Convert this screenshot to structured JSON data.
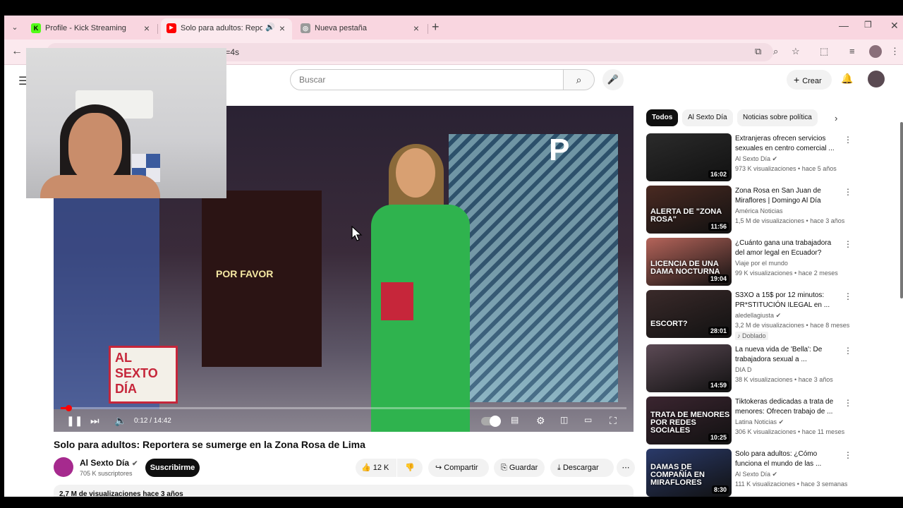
{
  "browser": {
    "tabs": [
      {
        "title": "Profile - Kick Streaming",
        "favicon": "K",
        "favicon_color": "#53fc18"
      },
      {
        "title": "Solo para adultos: Reporter",
        "favicon": "▶",
        "favicon_color": "#ff0000"
      },
      {
        "title": "Nueva pestaña",
        "favicon": "◎",
        "favicon_color": "#666666"
      }
    ],
    "url_visible": "t=4s"
  },
  "youtube": {
    "search_placeholder": "Buscar",
    "create_label": "Crear"
  },
  "player": {
    "overlay_text": "POR FAVOR",
    "show_logo_lines": [
      "AL",
      "SEXTO",
      "DÍA"
    ],
    "timecode": "0:12 / 14:42",
    "progress_fraction": 0.0136
  },
  "video": {
    "title": "Solo para adultos: Reportera se sumerge en la Zona Rosa de Lima",
    "channel": "Al Sexto Día",
    "subscribers": "705 K suscriptores",
    "subscribe_label": "Suscribirme",
    "likes": "12 K",
    "share_label": "Compartir",
    "save_label": "Guardar",
    "download_label": "Descargar",
    "views_line": "2,7 M de visualizaciones  hace 3 años"
  },
  "sidebar": {
    "chips": [
      "Todos",
      "Al Sexto Día",
      "Noticias sobre política"
    ],
    "recommendations": [
      {
        "title": "Extranjeras ofrecen servicios sexuales en centro comercial ...",
        "channel": "Al Sexto Día",
        "verified": true,
        "meta": "973 K visualizaciones • hace 5 años",
        "duration": "16:02",
        "thumb_color": "#2b2b2b",
        "thumb_text": ""
      },
      {
        "title": "Zona Rosa en San Juan de Miraflores | Domingo Al Día",
        "channel": "América Noticias",
        "verified": false,
        "meta": "1,5 M de visualizaciones • hace 3 años",
        "duration": "11:56",
        "thumb_color": "#4a2a22",
        "thumb_text": "ALERTA DE \"ZONA ROSA\""
      },
      {
        "title": "¿Cuánto gana una trabajadora del amor legal en Ecuador?",
        "channel": "Viaje por el mundo",
        "verified": false,
        "meta": "99 K visualizaciones • hace 2 meses",
        "duration": "19:04",
        "thumb_color": "#b5645a",
        "thumb_text": "LICENCIA DE UNA DAMA NOCTURNA"
      },
      {
        "title": "S3XO a 15$ por 12 minutos: PR*STITUCIÓN ILEGAL en ...",
        "channel": "aledellagiusta",
        "verified": true,
        "meta": "3,2 M de visualizaciones • hace 8 meses",
        "duration": "28:01",
        "thumb_color": "#3a2a2a",
        "thumb_text": "ESCORT?",
        "badge": "Doblado"
      },
      {
        "title": "La nueva vida de 'Bella': De trabajadora sexual a ...",
        "channel": "DIA D",
        "verified": false,
        "meta": "38 K visualizaciones • hace 3 años",
        "duration": "14:59",
        "thumb_color": "#5c4a55",
        "thumb_text": ""
      },
      {
        "title": "Tiktokeras dedicadas a trata de menores: Ofrecen trabajo de ...",
        "channel": "Latina Noticias",
        "verified": true,
        "meta": "306 K visualizaciones • hace 11 meses",
        "duration": "10:25",
        "thumb_color": "#3b2530",
        "thumb_text": "TRATA DE MENORES POR REDES SOCIALES"
      },
      {
        "title": "Solo para adultos: ¿Cómo funciona el mundo de las ...",
        "channel": "Al Sexto Día",
        "verified": true,
        "meta": "111 K visualizaciones • hace 3 semanas",
        "duration": "8:30",
        "thumb_color": "#2a3a6a",
        "thumb_text": "DAMAS DE COMPAÑÍA EN MIRAFLORES"
      }
    ]
  }
}
